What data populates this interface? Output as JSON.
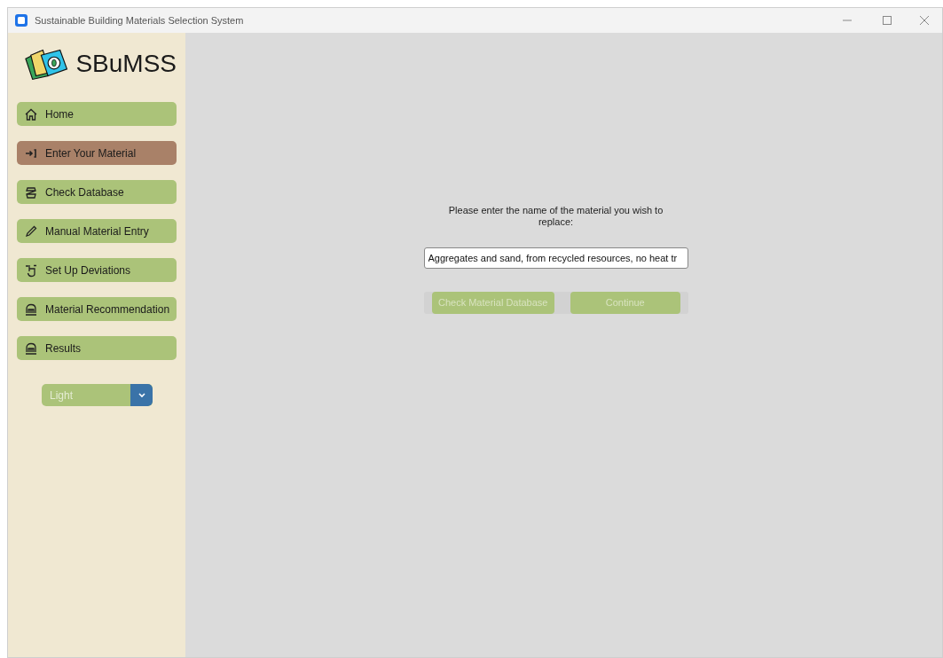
{
  "window": {
    "title": "Sustainable Building Materials Selection System"
  },
  "sidebar": {
    "logo": "SBuMSS",
    "items": [
      {
        "label": "Home",
        "kind": "home",
        "selected": false
      },
      {
        "label": "Enter Your Material",
        "kind": "enter",
        "selected": true
      },
      {
        "label": "Check Database",
        "kind": "database",
        "selected": false
      },
      {
        "label": "Manual Material Entry",
        "kind": "pencil",
        "selected": false
      },
      {
        "label": "Set Up Deviations",
        "kind": "hand",
        "selected": false
      },
      {
        "label": "Material Recommendation",
        "kind": "building",
        "selected": false
      },
      {
        "label": "Results",
        "kind": "building",
        "selected": false
      }
    ],
    "theme_select": {
      "value": "Light"
    }
  },
  "main": {
    "prompt": "Please enter the name of the material you wish to replace:",
    "material_field": {
      "value": "Aggregates and sand, from recycled resources, no heat tr"
    },
    "buttons": [
      {
        "label": "Check Material Database",
        "disabled": true
      },
      {
        "label": "Continue",
        "disabled": true
      }
    ]
  }
}
